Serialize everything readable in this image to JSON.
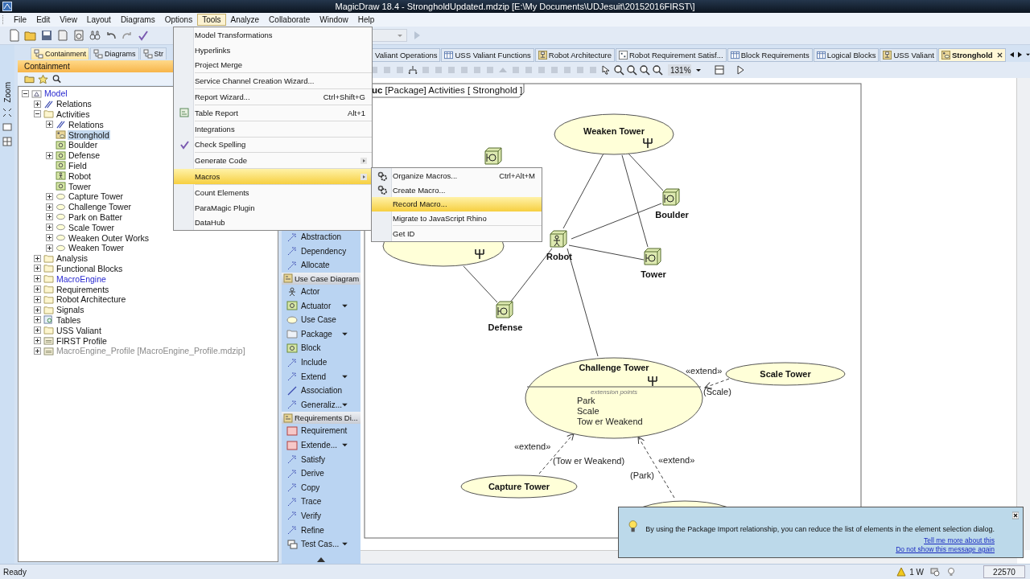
{
  "window": {
    "title": "MagicDraw 18.4 - StrongholdUpdated.mdzip [E:\\My Documents\\UDJesuit\\20152016FIRST\\]"
  },
  "menubar": [
    {
      "label": "File",
      "selected": false
    },
    {
      "label": "Edit",
      "selected": false
    },
    {
      "label": "View",
      "selected": false
    },
    {
      "label": "Layout",
      "selected": false
    },
    {
      "label": "Diagrams",
      "selected": false
    },
    {
      "label": "Options",
      "selected": false
    },
    {
      "label": "Tools",
      "selected": true
    },
    {
      "label": "Analyze",
      "selected": false
    },
    {
      "label": "Collaborate",
      "selected": false
    },
    {
      "label": "Window",
      "selected": false
    },
    {
      "label": "Help",
      "selected": false
    }
  ],
  "side_strip": {
    "label": "Zoom"
  },
  "browser": {
    "tabs": [
      {
        "label": "Containment",
        "selected": true
      },
      {
        "label": "Diagrams",
        "selected": false
      },
      {
        "label": "Str",
        "selected": false
      }
    ],
    "title": "Containment",
    "tree": [
      {
        "label": "Model",
        "kind": "model",
        "expanded": true,
        "selected": false,
        "color": "#2a2ad0",
        "children": [
          {
            "label": "Relations",
            "kind": "relations",
            "expanded": false,
            "selected": false
          },
          {
            "label": "Activities",
            "kind": "folder",
            "expanded": true,
            "selected": false,
            "children": [
              {
                "label": "Relations",
                "kind": "relations",
                "expanded": false,
                "selected": false
              },
              {
                "label": "Stronghold",
                "kind": "diagram",
                "selected": true
              },
              {
                "label": "Boulder",
                "kind": "block",
                "selected": false
              },
              {
                "label": "Defense",
                "kind": "block",
                "expanded": false,
                "selected": false
              },
              {
                "label": "Field",
                "kind": "block",
                "selected": false
              },
              {
                "label": "Robot",
                "kind": "actor",
                "selected": false
              },
              {
                "label": "Tower",
                "kind": "block",
                "selected": false
              },
              {
                "label": "Capture Tower",
                "kind": "usecase",
                "expanded": false,
                "selected": false
              },
              {
                "label": "Challenge Tower",
                "kind": "usecase",
                "expanded": false,
                "selected": false
              },
              {
                "label": "Park on Batter",
                "kind": "usecase",
                "expanded": false,
                "selected": false
              },
              {
                "label": "Scale Tower",
                "kind": "usecase",
                "expanded": false,
                "selected": false
              },
              {
                "label": "Weaken Outer Works",
                "kind": "usecase",
                "expanded": false,
                "selected": false
              },
              {
                "label": "Weaken Tower",
                "kind": "usecase",
                "expanded": false,
                "selected": false
              }
            ]
          },
          {
            "label": "Analysis",
            "kind": "folder",
            "expanded": false,
            "selected": false
          },
          {
            "label": "Functional Blocks",
            "kind": "folder",
            "expanded": false,
            "selected": false
          },
          {
            "label": "MacroEngine",
            "kind": "folder",
            "expanded": false,
            "selected": false,
            "color": "#2a2ad0"
          },
          {
            "label": "Requirements",
            "kind": "folder",
            "expanded": false,
            "selected": false
          },
          {
            "label": "Robot Architecture",
            "kind": "folder",
            "expanded": false,
            "selected": false
          },
          {
            "label": "Signals",
            "kind": "folder",
            "expanded": false,
            "selected": false
          },
          {
            "label": "Tables",
            "kind": "table",
            "expanded": false,
            "selected": false
          },
          {
            "label": "USS Valiant",
            "kind": "folder",
            "expanded": false,
            "selected": false
          },
          {
            "label": "FIRST Profile",
            "kind": "profile",
            "expanded": false,
            "selected": false
          },
          {
            "label": "MacroEngine_Profile [MacroEngine_Profile.mdzip]",
            "kind": "profile",
            "expanded": false,
            "selected": false,
            "color": "#8a8a8a"
          }
        ]
      }
    ]
  },
  "palette": [
    {
      "items": [
        {
          "label": "Abstraction",
          "kind": "relation",
          "dropdown": false
        },
        {
          "label": "Dependency",
          "kind": "relation",
          "dropdown": false
        },
        {
          "label": "Allocate",
          "kind": "relation",
          "dropdown": false
        }
      ]
    },
    {
      "title": "Use Case Diagram",
      "items": [
        {
          "label": "Actor",
          "kind": "actor",
          "dropdown": false
        },
        {
          "label": "Actuator",
          "kind": "block",
          "dropdown": true
        },
        {
          "label": "Use Case",
          "kind": "usecase",
          "dropdown": false
        },
        {
          "label": "Package",
          "kind": "package",
          "dropdown": true
        },
        {
          "label": "Block",
          "kind": "block",
          "dropdown": false
        },
        {
          "label": "Include",
          "kind": "relation",
          "dropdown": false
        },
        {
          "label": "Extend",
          "kind": "relation",
          "dropdown": true
        },
        {
          "label": "Association",
          "kind": "line",
          "dropdown": false
        },
        {
          "label": "Generaliz...",
          "kind": "relation",
          "dropdown": true
        }
      ]
    },
    {
      "title": "Requirements Di...",
      "items": [
        {
          "label": "Requirement",
          "kind": "requirement",
          "dropdown": false
        },
        {
          "label": "Extende...",
          "kind": "requirement",
          "dropdown": true
        },
        {
          "label": "Satisfy",
          "kind": "relation",
          "dropdown": false
        },
        {
          "label": "Derive",
          "kind": "relation",
          "dropdown": false
        },
        {
          "label": "Copy",
          "kind": "relation",
          "dropdown": false
        },
        {
          "label": "Trace",
          "kind": "relation",
          "dropdown": false
        },
        {
          "label": "Verify",
          "kind": "relation",
          "dropdown": false
        },
        {
          "label": "Refine",
          "kind": "relation",
          "dropdown": false
        },
        {
          "label": "Test Cas...",
          "kind": "testcase",
          "dropdown": true
        }
      ]
    }
  ],
  "editor": {
    "tabs": [
      {
        "label": "Valiant Operations",
        "selected": false
      },
      {
        "label": "USS Valiant Functions",
        "kind": "table",
        "selected": false
      },
      {
        "label": "Robot Architecture",
        "kind": "diagram",
        "selected": false
      },
      {
        "label": "Robot Requirement Satisf...",
        "kind": "matrix",
        "selected": false
      },
      {
        "label": "Block Requirements",
        "kind": "table",
        "selected": false
      },
      {
        "label": "Logical Blocks",
        "kind": "table",
        "selected": false
      },
      {
        "label": "USS Valiant",
        "kind": "diagram",
        "selected": false
      },
      {
        "label": "Stronghold",
        "kind": "usecase",
        "selected": true
      }
    ],
    "zoom": "131%",
    "frame_label": "**uc** [Package] Activities [ Stronghold ]",
    "nodes": [
      {
        "kind": "usecase",
        "label": "Weaken Tower",
        "behavior": true
      },
      {
        "kind": "usecase",
        "behavior": true
      },
      {
        "kind": "block"
      },
      {
        "kind": "actor",
        "label": "Robot"
      },
      {
        "kind": "block",
        "label": "Boulder"
      },
      {
        "kind": "block",
        "label": "Tower"
      },
      {
        "kind": "block",
        "label": "Defense"
      },
      {
        "kind": "usecase",
        "label": "Challenge Tower",
        "behavior": true,
        "extension_points": {
          "title": "extension points",
          "items": [
            "Park",
            "Scale",
            "Tow er Weakend"
          ]
        }
      },
      {
        "kind": "usecase",
        "label": "Scale Tower",
        "behavior": false
      },
      {
        "kind": "usecase",
        "label": "Capture Tower",
        "behavior": false
      },
      {
        "kind": "usecase",
        "behavior": false
      }
    ],
    "edges": [
      {
        "kind": "association"
      },
      {
        "kind": "association"
      },
      {
        "kind": "association"
      },
      {
        "kind": "association"
      },
      {
        "kind": "association"
      },
      {
        "kind": "association"
      },
      {
        "kind": "association"
      },
      {
        "kind": "association"
      },
      {
        "kind": "extend",
        "stereotype": "«extend»",
        "condition": "(Scale)"
      },
      {
        "kind": "extend",
        "stereotype": "«extend»",
        "condition": "(Tow er Weakend)"
      },
      {
        "kind": "extend",
        "stereotype": "«extend»",
        "condition": "(Park)"
      }
    ]
  },
  "tools_menu": {
    "items": [
      {
        "label": "Model Transformations",
        "selected": false
      },
      {
        "label": "Hyperlinks",
        "selected": false
      },
      {
        "label": "Project Merge",
        "selected": false,
        "separator_after": true
      },
      {
        "label": "Service Channel Creation Wizard...",
        "selected": false,
        "separator_after": true
      },
      {
        "label": "Report Wizard...",
        "shortcut": "Ctrl+Shift+G",
        "selected": false,
        "separator_after": true
      },
      {
        "label": "Table Report",
        "shortcut": "Alt+1",
        "selected": false,
        "separator_after": true
      },
      {
        "label": "Integrations",
        "selected": false,
        "separator_after": true
      },
      {
        "label": "Check Spelling",
        "selected": false,
        "separator_after": true
      },
      {
        "label": "Generate Code",
        "submenu": true,
        "selected": false,
        "separator_after": true
      },
      {
        "label": "Macros",
        "submenu": true,
        "selected": true,
        "separator_after": true
      },
      {
        "label": "Count Elements",
        "selected": false
      },
      {
        "label": "ParaMagic Plugin",
        "selected": false
      },
      {
        "label": "DataHub",
        "selected": false
      }
    ]
  },
  "macros_submenu": {
    "items": [
      {
        "label": "Organize Macros...",
        "shortcut": "Ctrl+Alt+M",
        "selected": false
      },
      {
        "label": "Create Macro...",
        "selected": false
      },
      {
        "label": "Record Macro...",
        "selected": true
      },
      {
        "label": "Migrate to JavaScript Rhino",
        "selected": false,
        "separator_after": true
      },
      {
        "label": "Get ID",
        "selected": false
      }
    ]
  },
  "notification": {
    "message": "By using the Package Import relationship, you can reduce the list of elements in the element selection dialog.",
    "links": [
      "Tell me more about this",
      "Do not show this message again"
    ]
  },
  "status_bar": {
    "text": "Ready",
    "warnings": "1 W",
    "memory": "22570"
  }
}
